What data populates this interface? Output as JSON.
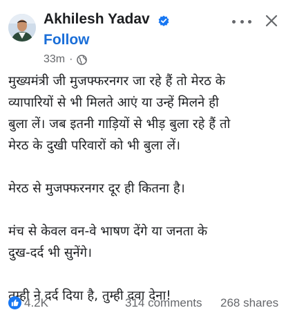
{
  "post": {
    "author_name": "Akhilesh Yadav",
    "follow_label": "Follow",
    "timestamp": "33m",
    "privacy_icon": "globe-icon",
    "verified_icon": "verified-badge-icon",
    "menu_icon": "more-options-icon",
    "close_icon": "close-icon",
    "paragraphs": {
      "p1": {
        "line1": "मुख्यमंत्री जी मुजफ्फरनगर जा रहे हैं तो मेरठ के",
        "line2": "व्यापारियों से भी मिलते आएं या उन्हें मिलने ही",
        "line3": "बुला लें। जब इतनी गाड़ियों से भीड़ बुला रहे हैं तो",
        "line4": "मेरठ के दुखी परिवारों को भी बुला लें।"
      },
      "p2": {
        "line1": "मेरठ से मुजफ्फरनगर दूर ही कितना है।"
      },
      "p3": {
        "line1": "मंच से केवल वन-वे भाषण देंगे या जनता के",
        "line2": "दुख-दर्द भी सुनेंगे।"
      },
      "p4": {
        "line1": "तुम्ही ने दर्द दिया है, तुम्ही दवा देना!"
      }
    }
  },
  "engagement": {
    "reactions": "4.2K",
    "comments": "314 comments",
    "shares": "268 shares",
    "reaction_icon": "like-icon"
  },
  "colors": {
    "accent": "#1a6ed8",
    "text": "#1c1e21",
    "secondary_text": "#65676b",
    "background": "#ffffff"
  }
}
